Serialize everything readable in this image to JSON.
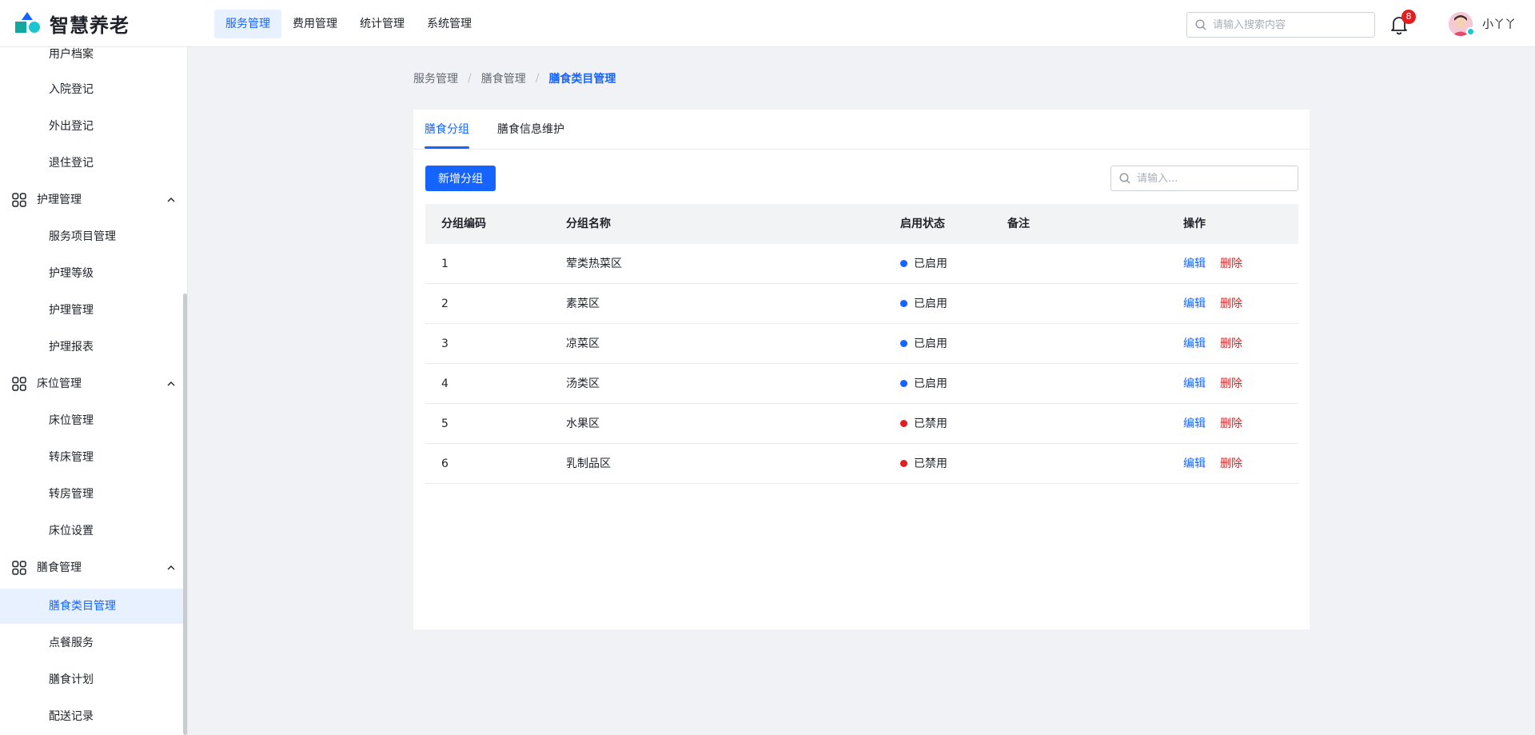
{
  "app": {
    "name": "智慧养老",
    "colors": {
      "primary": "#1664ff",
      "danger": "#e02020",
      "logo_blue": "#1664ff",
      "logo_green": "#13a89e",
      "logo_cyan": "#1ac6d0"
    }
  },
  "topnav": {
    "items": [
      {
        "label": "服务管理",
        "active": true
      },
      {
        "label": "费用管理",
        "active": false
      },
      {
        "label": "统计管理",
        "active": false
      },
      {
        "label": "系统管理",
        "active": false
      }
    ]
  },
  "header": {
    "search_placeholder": "请输入搜索内容",
    "notification_count": "8",
    "username": "小丫丫"
  },
  "sidebar": {
    "items": [
      {
        "label": "用户档案"
      },
      {
        "label": "入院登记"
      },
      {
        "label": "外出登记"
      },
      {
        "label": "退住登记"
      }
    ],
    "groups": [
      {
        "label": "护理管理",
        "icon": "grid-icon",
        "children": [
          "服务项目管理",
          "护理等级",
          "护理管理",
          "护理报表"
        ]
      },
      {
        "label": "床位管理",
        "icon": "grid-icon",
        "children": [
          "床位管理",
          "转床管理",
          "转房管理",
          "床位设置"
        ]
      },
      {
        "label": "膳食管理",
        "icon": "grid-icon",
        "children": [
          "膳食类目管理",
          "点餐服务",
          "膳食计划",
          "配送记录"
        ]
      }
    ],
    "active_item": "膳食类目管理"
  },
  "breadcrumb": {
    "items": [
      "服务管理",
      "膳食管理",
      "膳食类目管理"
    ],
    "separator": "/"
  },
  "tabs": [
    {
      "label": "膳食分组",
      "active": true
    },
    {
      "label": "膳食信息维护",
      "active": false
    }
  ],
  "toolbar": {
    "add_label": "新增分组",
    "search_placeholder": "请输入..."
  },
  "table": {
    "columns": [
      "分组编码",
      "分组名称",
      "启用状态",
      "备注",
      "操作"
    ],
    "rows": [
      {
        "code": "1",
        "name": "荤类热菜区",
        "status": "已启用",
        "status_color": "#1664ff",
        "remark": ""
      },
      {
        "code": "2",
        "name": "素菜区",
        "status": "已启用",
        "status_color": "#1664ff",
        "remark": ""
      },
      {
        "code": "3",
        "name": "凉菜区",
        "status": "已启用",
        "status_color": "#1664ff",
        "remark": ""
      },
      {
        "code": "4",
        "name": "汤类区",
        "status": "已启用",
        "status_color": "#1664ff",
        "remark": ""
      },
      {
        "code": "5",
        "name": "水果区",
        "status": "已禁用",
        "status_color": "#e02020",
        "remark": ""
      },
      {
        "code": "6",
        "name": "乳制品区",
        "status": "已禁用",
        "status_color": "#e02020",
        "remark": ""
      }
    ],
    "actions": {
      "edit": "编辑",
      "delete": "删除"
    }
  }
}
